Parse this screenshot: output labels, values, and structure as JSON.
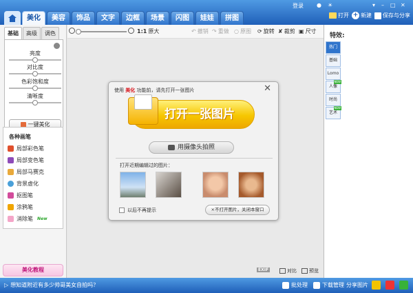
{
  "topbar": {
    "tabs": [
      "美化",
      "美容",
      "饰品",
      "文字",
      "边框",
      "场景",
      "闪图",
      "娃娃",
      "拼图"
    ],
    "active_tab": "美化",
    "login": "登录",
    "open": "打开",
    "new": "新建",
    "save": "保存与分享"
  },
  "left": {
    "subtabs": [
      "基础",
      "高级",
      "调色"
    ],
    "adjustments": [
      "亮度",
      "对比度",
      "色彩饱和度",
      "清晰度"
    ],
    "one_key": "一键美化",
    "brushes_title": "各种画笔",
    "brushes": [
      "局部彩色笔",
      "局部变色笔",
      "局部马赛克",
      "背景虚化",
      "抠图笔",
      "涂鸦笔",
      "消除笔"
    ],
    "new_badge": "New",
    "tutorial": "美化教程"
  },
  "toolbar": {
    "ratio": "1:1",
    "original": "原大",
    "undo": "撤销",
    "redo": "重做",
    "original_img": "原图",
    "rotate": "旋转",
    "crop": "裁剪",
    "size": "尺寸"
  },
  "right": {
    "title": "特效:",
    "tabs": [
      "热门",
      "基础",
      "Lomo",
      "人像",
      "时尚",
      "艺术"
    ],
    "new_badge": "NEW"
  },
  "dialog": {
    "prefix": "使用",
    "feature": "美化",
    "suffix": "功能前，请先打开一张图片",
    "open_button": "打开一张图片",
    "camera_button": "用摄像头拍照",
    "recent_label": "打开近期编辑过的图片：",
    "no_show": "以后不再提示",
    "no_open": "×不打开图片，关闭本窗口"
  },
  "canvas": {
    "exif": "EXIF",
    "compare": "对比",
    "preview": "预览"
  },
  "status": {
    "message": "想知道附近有多少帅哥美女自拍吗？",
    "batch": "批处理",
    "download": "下载管理",
    "share": "分享图片"
  }
}
